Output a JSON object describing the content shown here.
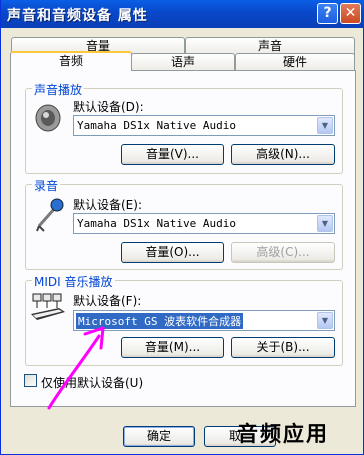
{
  "window": {
    "title": "声音和音频设备 属性",
    "help_glyph": "?",
    "close_glyph": "✕"
  },
  "tabs": {
    "row_back": [
      "音量",
      "声音"
    ],
    "row_front": [
      "音频",
      "语声",
      "硬件"
    ],
    "active": "音频"
  },
  "playback": {
    "group_label": "声音播放",
    "default_label": "默认设备(D):",
    "device": "Yamaha DS1x Native Audio",
    "volume_button": "音量(V)...",
    "advanced_button": "高级(N)...",
    "icon": "speaker-icon"
  },
  "recording": {
    "group_label": "录音",
    "default_label": "默认设备(E):",
    "device": "Yamaha DS1x Native Audio",
    "volume_button": "音量(O)...",
    "advanced_button": "高级(C)...",
    "icon": "microphone-icon"
  },
  "midi": {
    "group_label": "MIDI 音乐播放",
    "default_label": "默认设备(F):",
    "device": "Microsoft GS 波表软件合成器",
    "volume_button": "音量(M)...",
    "about_button": "关于(B)...",
    "icon": "midi-keyboard-icon"
  },
  "only_default": {
    "label": "仅使用默认设备(U)",
    "checked": false
  },
  "footer": {
    "ok_button": "确定",
    "cancel_button": "取"
  },
  "watermark": "音频应用",
  "colors": {
    "title_blue": "#0a5fe6",
    "annotation_arrow": "#ff00ff",
    "group_label": "#0046d5",
    "selection": "#316ac5"
  }
}
